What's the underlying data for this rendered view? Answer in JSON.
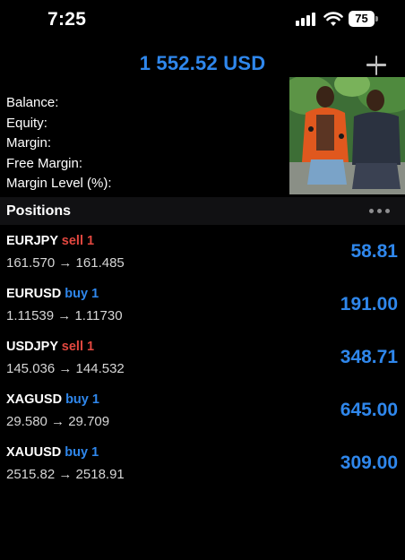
{
  "status_bar": {
    "time": "7:25",
    "battery": "75"
  },
  "header": {
    "title": "1 552.52 USD",
    "add_icon": "plus-icon"
  },
  "summary": {
    "balance_label": "Balance:",
    "equity_label": "Equity:",
    "margin_label": "Margin:",
    "free_margin_label": "Free Margin:",
    "margin_level_label": "Margin Level (%):"
  },
  "positions": {
    "title": "Positions",
    "items": [
      {
        "symbol": "EURJPY",
        "side": "sell 1",
        "prices": "161.570 → 161.485",
        "profit": "58.81"
      },
      {
        "symbol": "EURUSD",
        "side": "buy 1",
        "prices": "1.11539 → 1.11730",
        "profit": "191.00"
      },
      {
        "symbol": "USDJPY",
        "side": "sell 1",
        "prices": "145.036 → 144.532",
        "profit": "348.71"
      },
      {
        "symbol": "XAGUSD",
        "side": "buy 1",
        "prices": "29.580 → 29.709",
        "profit": "645.00"
      },
      {
        "symbol": "XAUUSD",
        "side": "buy 1",
        "prices": "2515.82 → 2518.91",
        "profit": "309.00"
      }
    ]
  },
  "colors": {
    "accent_blue": "#2f87ec",
    "sell_red": "#e2473f",
    "background": "#000000"
  }
}
